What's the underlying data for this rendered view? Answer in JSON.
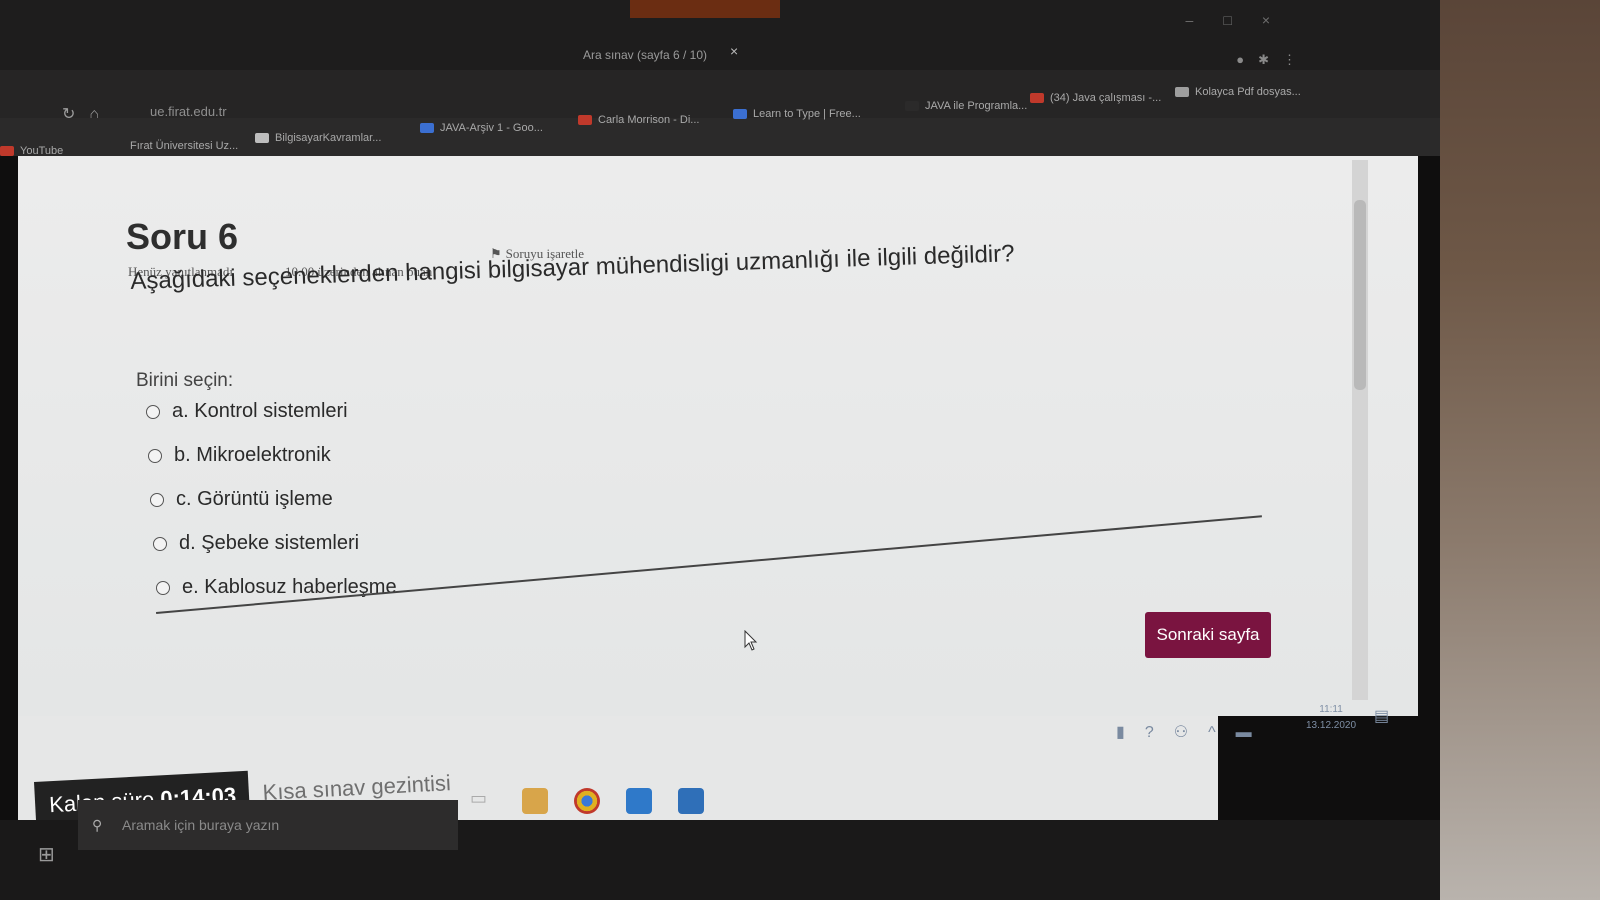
{
  "browser": {
    "tab_title": "Ara sınav (sayfa 6 / 10)",
    "tab_close": "×",
    "url": "ue.firat.edu.tr",
    "bookmarks": [
      {
        "label": "YouTube",
        "color": "#c0392b"
      },
      {
        "label": "Fırat Üniversitesi Uz...",
        "color": "#2b2a2a"
      },
      {
        "label": "BilgisayarKavramlar...",
        "color": "#bdbdbd"
      },
      {
        "label": "JAVA-Arşiv 1 - Goo...",
        "color": "#3b6fd1"
      },
      {
        "label": "Carla Morrison - Di...",
        "color": "#c0392b"
      },
      {
        "label": "Learn to Type | Free...",
        "color": "#3b6fd1"
      },
      {
        "label": "JAVA ile Programla...",
        "color": "#2b2a2a"
      },
      {
        "label": "(34) Java çalışması -...",
        "color": "#c0392b"
      },
      {
        "label": "Kolayca Pdf dosyas...",
        "color": "#9e9e9e"
      }
    ]
  },
  "question": {
    "title": "Soru 6",
    "status": "Henüz yanıtlanmadı",
    "points": "10.00 üzerinden alınan puan",
    "flag_label": "Soruyu işaretle",
    "text": "Aşağıdaki seçeneklerden hangisi bilgisayar mühendisligi uzmanlığı ile ilgili değildir?",
    "prompt": "Birini seçin:",
    "options": [
      "a. Kontrol sistemleri",
      "b. Mikroelektronik",
      "c. Görüntü işleme",
      "d. Şebeke sistemleri",
      "e. Kablosuz haberleşme"
    ]
  },
  "next_button": "Sonraki sayfa",
  "timer": {
    "label": "Kalan süre",
    "value": "0:14:03"
  },
  "quiz_nav": "Kısa sınav gezintisi",
  "taskbar": {
    "search_placeholder": "Aramak için buraya yazın",
    "time": "11:11",
    "date": "13.12.2020"
  },
  "colors": {
    "accent": "#7a1440",
    "page_bg": "#e8e9e9",
    "timer_bg": "#222222"
  }
}
